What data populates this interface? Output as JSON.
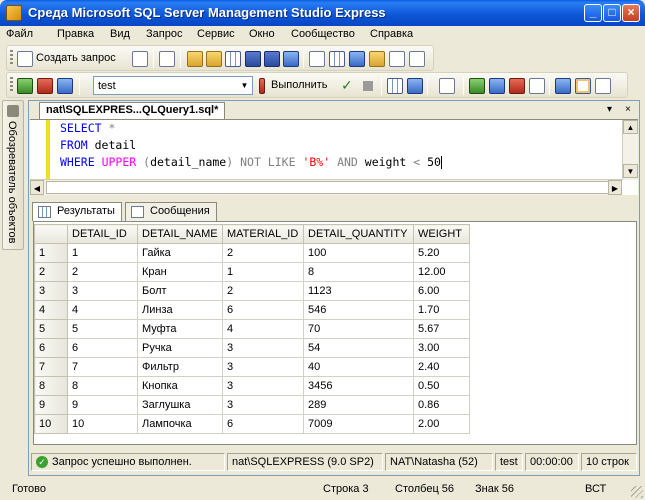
{
  "window": {
    "title": "Среда Microsoft SQL Server Management Studio Express",
    "min_glyph": "_",
    "max_glyph": "□",
    "close_glyph": "×"
  },
  "menu": [
    "Файл",
    "Правка",
    "Вид",
    "Запрос",
    "Сервис",
    "Окно",
    "Сообщество",
    "Справка"
  ],
  "toolbar1": {
    "new_query_label": "Создать запрос"
  },
  "toolbar2": {
    "database": "test",
    "execute_label": "Выполнить"
  },
  "side_panel": {
    "label": "Обозреватель объектов"
  },
  "document": {
    "tab_title": "nat\\SQLEXPRES...QLQuery1.sql*",
    "dropdown_glyph": "▾",
    "close_glyph": "×",
    "query_lines": [
      [
        {
          "t": "SELECT",
          "c": "kw"
        },
        {
          "t": " ",
          "c": ""
        },
        {
          "t": "*",
          "c": "op"
        }
      ],
      [
        {
          "t": "FROM",
          "c": "kw"
        },
        {
          "t": " detail",
          "c": ""
        }
      ],
      [
        {
          "t": "WHERE",
          "c": "kw"
        },
        {
          "t": " ",
          "c": ""
        },
        {
          "t": "UPPER",
          "c": "fn"
        },
        {
          "t": " ",
          "c": ""
        },
        {
          "t": "(",
          "c": "op"
        },
        {
          "t": "detail_name",
          "c": ""
        },
        {
          "t": ")",
          "c": "op"
        },
        {
          "t": " ",
          "c": ""
        },
        {
          "t": "NOT LIKE",
          "c": "op"
        },
        {
          "t": " ",
          "c": ""
        },
        {
          "t": "'B%'",
          "c": "str"
        },
        {
          "t": " ",
          "c": ""
        },
        {
          "t": "AND",
          "c": "op"
        },
        {
          "t": " weight ",
          "c": ""
        },
        {
          "t": "<",
          "c": "op"
        },
        {
          "t": " 50",
          "c": ""
        }
      ]
    ]
  },
  "results": {
    "tabs": {
      "results": "Результаты",
      "messages": "Сообщения"
    },
    "columns": [
      "DETAIL_ID",
      "DETAIL_NAME",
      "MATERIAL_ID",
      "DETAIL_QUANTITY",
      "WEIGHT"
    ],
    "rows": [
      [
        "1",
        "1",
        "Гайка",
        "2",
        "100",
        "5.20"
      ],
      [
        "2",
        "2",
        "Кран",
        "1",
        "8",
        "12.00"
      ],
      [
        "3",
        "3",
        "Болт",
        "2",
        "1123",
        "6.00"
      ],
      [
        "4",
        "4",
        "Линза",
        "6",
        "546",
        "1.70"
      ],
      [
        "5",
        "5",
        "Муфта",
        "4",
        "70",
        "5.67"
      ],
      [
        "6",
        "6",
        "Ручка",
        "3",
        "54",
        "3.00"
      ],
      [
        "7",
        "7",
        "Фильтр",
        "3",
        "40",
        "2.40"
      ],
      [
        "8",
        "8",
        "Кнопка",
        "3",
        "3456",
        "0.50"
      ],
      [
        "9",
        "9",
        "Заглушка",
        "3",
        "289",
        "0.86"
      ],
      [
        "10",
        "10",
        "Лампочка",
        "6",
        "7009",
        "2.00"
      ]
    ]
  },
  "query_status": {
    "message": "Запрос успешно выполнен.",
    "server": "nat\\SQLEXPRESS (9.0 SP2)",
    "user": "NAT\\Natasha (52)",
    "database": "test",
    "elapsed": "00:00:00",
    "row_count": "10 строк"
  },
  "statusbar": {
    "ready": "Готово",
    "line": "Строка 3",
    "column": "Столбец 56",
    "char": "Знак 56",
    "mode": "ВСТ"
  }
}
